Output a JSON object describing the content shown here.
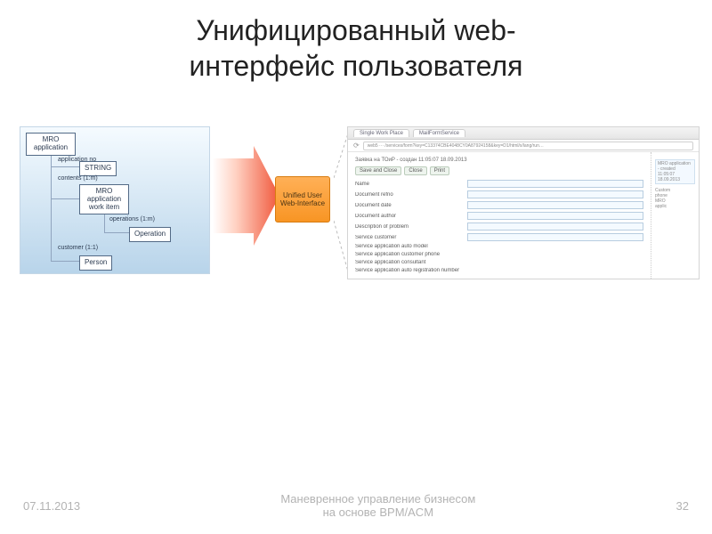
{
  "slide": {
    "title_line1": "Унифицированный web-",
    "title_line2": "интерфейс пользователя",
    "footer_date": "07.11.2013",
    "footer_center_l1": "Маневренное управление бизнесом",
    "footer_center_l2": "на основе BPM/ACM",
    "footer_page": "32"
  },
  "diagram": {
    "root": "MRO application",
    "edge_app_no": "application no",
    "node_string": "STRING",
    "edge_contents": "contents (1:m)",
    "node_workitem_l1": "MRO",
    "node_workitem_l2": "application",
    "node_workitem_l3": "work item",
    "edge_operations": "operations (1:m)",
    "node_operation": "Operation",
    "edge_customer": "customer (1:1)",
    "node_person": "Person"
  },
  "center": {
    "label": "Unified User Web-Interface"
  },
  "screenshot": {
    "tab1": "Single Work Place",
    "tab2": "MailFormService",
    "url": "web5 ··· /services/form?key=C13374CBE4048CY0A87924158&key=D1/html/x/lang/run…",
    "caption": "Заявка на ТОиР - создан 11:05:07 18.09.2013",
    "btn_save_close": "Save and Close",
    "btn_close": "Close",
    "btn_print": "Print",
    "fields": [
      "Name",
      "Document refno",
      "Document date",
      "Document author",
      "Description of problem",
      "Service customer",
      "Service application auto model",
      "Service application customer phone",
      "Service application consultant",
      "Service application auto registration number"
    ],
    "right_heading": "MRO application - created 11:05:07 18.09.2013",
    "right_items": [
      "Custom",
      "phone",
      "MRO",
      "applic"
    ]
  }
}
